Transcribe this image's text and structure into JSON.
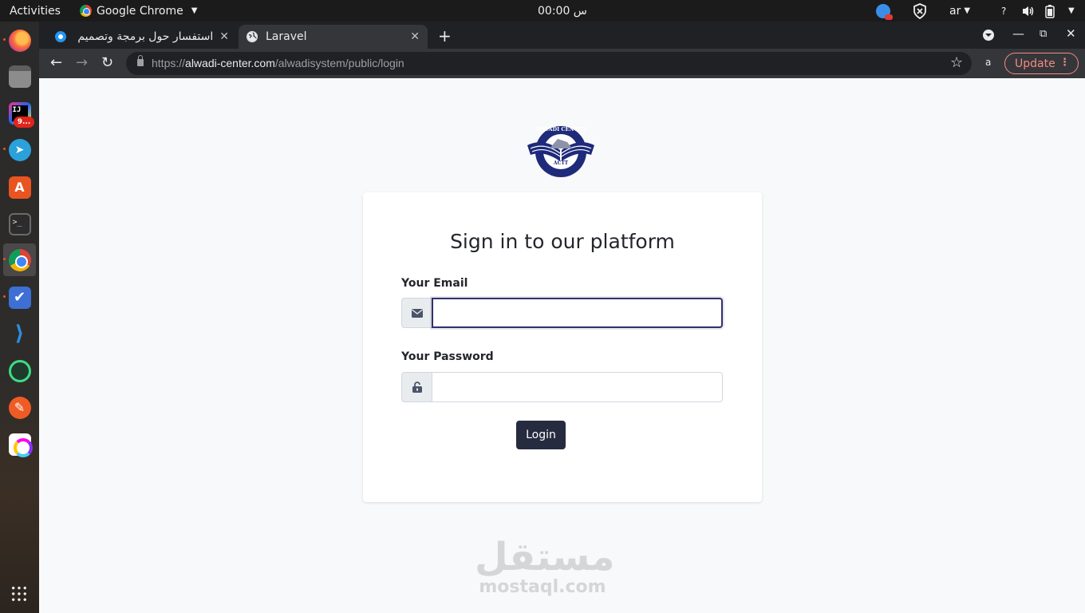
{
  "system": {
    "activities": "Activities",
    "app_menu": "Google Chrome",
    "clock": "س 00:00",
    "language": "ar",
    "help_icon_label": "?"
  },
  "dock": {
    "telegram_badge": "9...",
    "apps": [
      "firefox-icon",
      "files-icon",
      "intellij-icon",
      "telegram-icon",
      "software-store-icon",
      "terminal-icon",
      "chrome-icon",
      "tasks-icon",
      "vscode-icon",
      "android-studio-icon",
      "postman-icon",
      "clickup-icon",
      "app-grid-icon"
    ]
  },
  "browser": {
    "tabs": [
      {
        "title": "استفسار حول برمجة وتصميم"
      },
      {
        "title": "Laravel"
      }
    ],
    "url_prefix": "https://",
    "url_host": "alwadi-center.com",
    "url_path": "/alwadisystem/public/login",
    "profile_initial": "a",
    "update_label": "Update"
  },
  "page": {
    "logo_top_text": "ALWADI CENTER",
    "logo_bottom_text": "ACTT",
    "title": "Sign in to our platform",
    "email_label": "Your Email",
    "email_value": "",
    "password_label": "Your Password",
    "password_value": "",
    "login_label": "Login",
    "watermark_ar": "مستقل",
    "watermark_en": "mostaql.com"
  },
  "colors": {
    "primary_button": "#262b40",
    "focus_border": "#31316a",
    "update_accent": "#f28b82",
    "page_background": "#f8f9fa"
  }
}
